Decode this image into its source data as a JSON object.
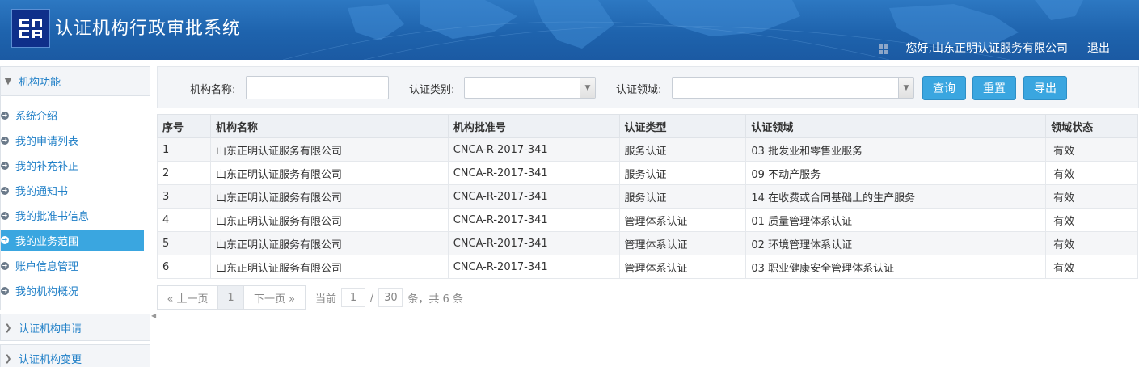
{
  "header": {
    "title": "认证机构行政审批系统",
    "greeting": "您好,山东正明认证服务有限公司",
    "logout": "退出",
    "logo_icon": "cnca-logo-icon",
    "colors": {
      "header_bg": "#1e63ad",
      "accent": "#3aa6e0"
    }
  },
  "sidebar": {
    "section_title": "机构功能",
    "items": [
      {
        "label": "系统介绍"
      },
      {
        "label": "我的申请列表"
      },
      {
        "label": "我的补充补正"
      },
      {
        "label": "我的通知书"
      },
      {
        "label": "我的批准书信息"
      },
      {
        "label": "我的业务范围",
        "active": true
      },
      {
        "label": "账户信息管理"
      },
      {
        "label": "我的机构概况"
      }
    ],
    "other_sections": [
      {
        "label": "认证机构申请"
      },
      {
        "label": "认证机构变更"
      }
    ]
  },
  "search": {
    "org_name_label": "机构名称:",
    "org_name_value": "",
    "cert_type_label": "认证类别:",
    "cert_type_value": "",
    "cert_field_label": "认证领域:",
    "cert_field_value": "",
    "query_button": "查询",
    "reset_button": "重置",
    "export_button": "导出"
  },
  "table": {
    "columns": [
      "序号",
      "机构名称",
      "机构批准号",
      "认证类型",
      "认证领域",
      "领域状态"
    ],
    "rows": [
      [
        "1",
        "山东正明认证服务有限公司",
        "CNCA-R-2017-341",
        "服务认证",
        "03 批发业和零售业服务",
        "有效"
      ],
      [
        "2",
        "山东正明认证服务有限公司",
        "CNCA-R-2017-341",
        "服务认证",
        "09 不动产服务",
        "有效"
      ],
      [
        "3",
        "山东正明认证服务有限公司",
        "CNCA-R-2017-341",
        "服务认证",
        "14 在收费或合同基础上的生产服务",
        "有效"
      ],
      [
        "4",
        "山东正明认证服务有限公司",
        "CNCA-R-2017-341",
        "管理体系认证",
        "01 质量管理体系认证",
        "有效"
      ],
      [
        "5",
        "山东正明认证服务有限公司",
        "CNCA-R-2017-341",
        "管理体系认证",
        "02 环境管理体系认证",
        "有效"
      ],
      [
        "6",
        "山东正明认证服务有限公司",
        "CNCA-R-2017-341",
        "管理体系认证",
        "03 职业健康安全管理体系认证",
        "有效"
      ]
    ]
  },
  "pager": {
    "prev": "« 上一页",
    "current_page": "1",
    "next": "下一页 »",
    "current_label": "当前",
    "page_input": "1",
    "separator": "/",
    "page_size": "30",
    "total_text": "条，共 6 条"
  }
}
